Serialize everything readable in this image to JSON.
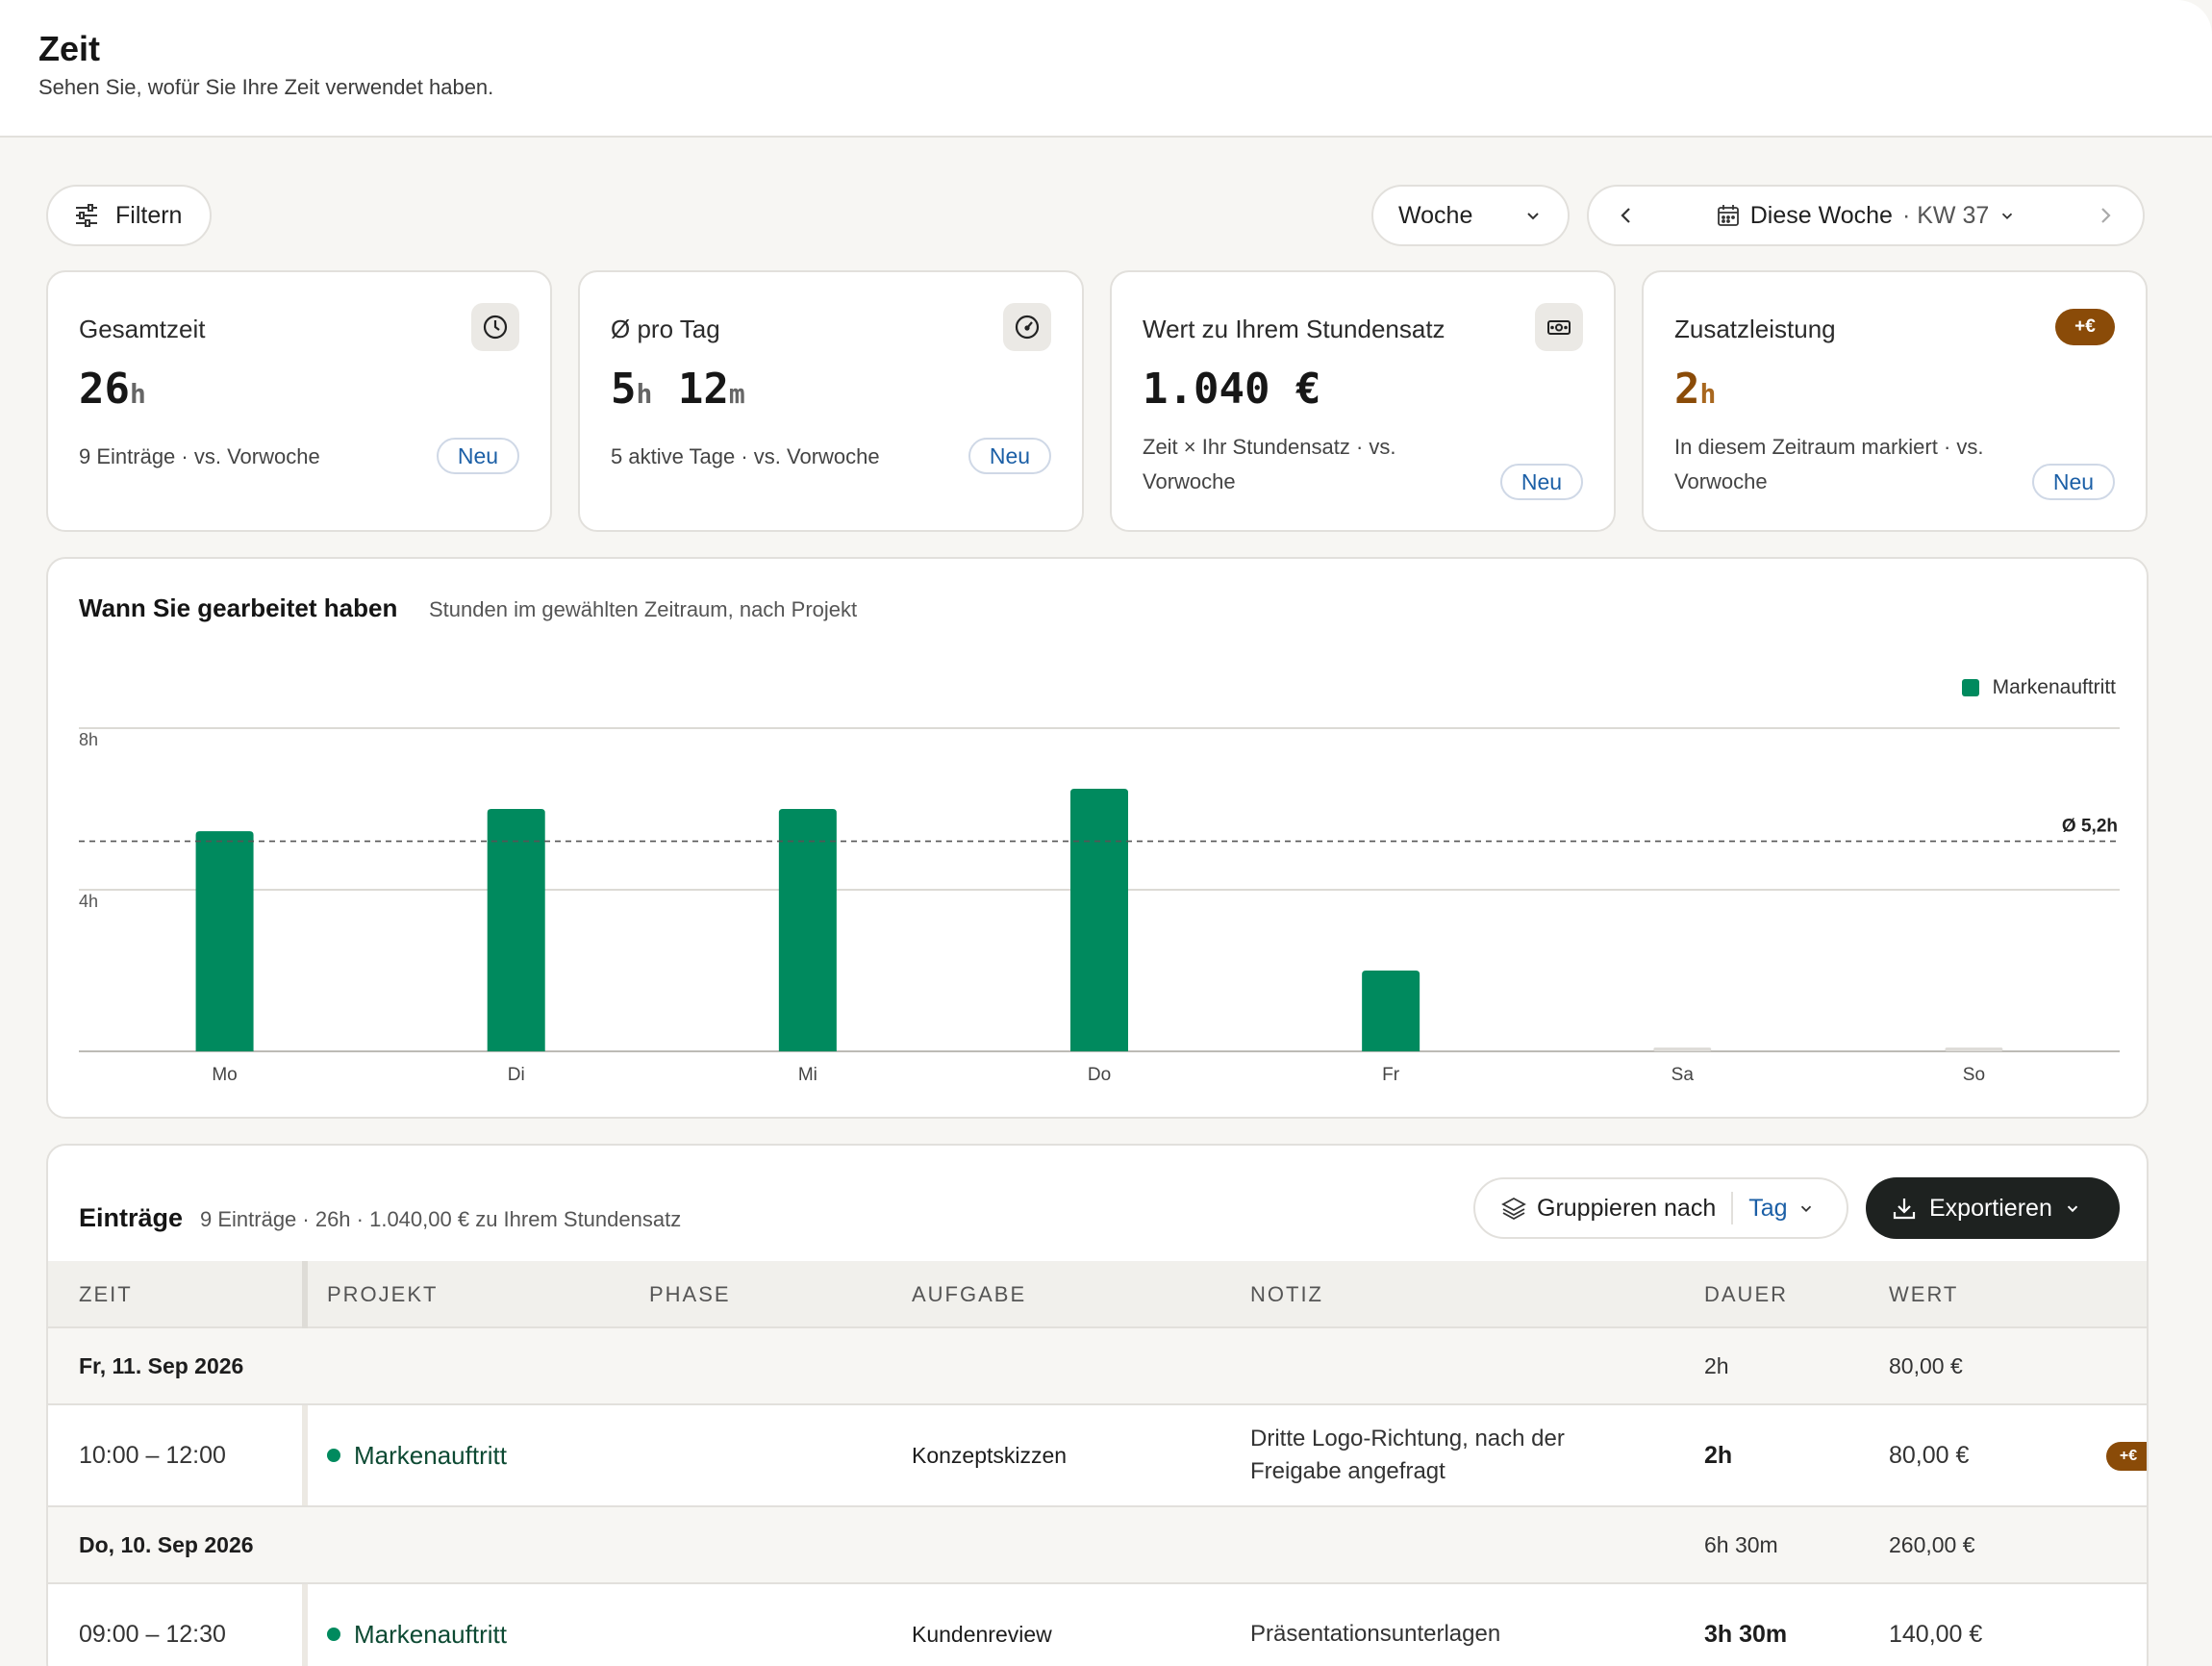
{
  "header": {
    "title": "Zeit",
    "subtitle": "Sehen Sie, wofür Sie Ihre Zeit verwendet haben."
  },
  "toolbar": {
    "filter_label": "Filtern",
    "period_select": "Woche",
    "week_label": "Diese Woche",
    "week_suffix": "· KW 37"
  },
  "cards": [
    {
      "title": "Gesamtzeit",
      "value": "26",
      "unit": "h",
      "sub": "9 Einträge · vs. Vorwoche",
      "badge": "Neu"
    },
    {
      "title": "Ø pro Tag",
      "value_h": "5",
      "unit_h": "h",
      "value_m": "12",
      "unit_m": "m",
      "sub": "5 aktive Tage · vs. Vorwoche",
      "badge": "Neu"
    },
    {
      "title": "Wert zu Ihrem Stundensatz",
      "value": "1.040 €",
      "sub_line1": "Zeit × Ihr Stundensatz · vs.",
      "sub_line2": "Vorwoche",
      "badge": "Neu"
    },
    {
      "title": "Zusatzleistung",
      "value": "2",
      "unit": "h",
      "tag": "+€",
      "sub_line1": "In diesem Zeitraum markiert · vs.",
      "sub_line2": "Vorwoche",
      "badge": "Neu"
    }
  ],
  "chart_card": {
    "title": "Wann Sie gearbeitet haben",
    "subtitle": "Stunden im gewählten Zeitraum, nach Projekt"
  },
  "chart_data": {
    "type": "bar",
    "categories": [
      "Mo",
      "Di",
      "Mi",
      "Do",
      "Fr",
      "Sa",
      "So"
    ],
    "series": [
      {
        "name": "Markenauftritt",
        "values": [
          5.45,
          6.0,
          6.0,
          6.5,
          2.0,
          0,
          0
        ],
        "color": "#008a5e"
      }
    ],
    "y_ticks": [
      "8h",
      "4h"
    ],
    "y_tick_values": [
      8,
      4
    ],
    "ylim": [
      0,
      8
    ],
    "average": 5.2,
    "average_label": "Ø 5,2h",
    "legend_position": "top-right",
    "grid": true
  },
  "entries": {
    "title": "Einträge",
    "subtitle": "9 Einträge · 26h · 1.040,00 € zu Ihrem Stundensatz",
    "group_label": "Gruppieren nach",
    "group_value": "Tag",
    "export_label": "Exportieren",
    "columns": [
      "ZEIT",
      "PROJEKT",
      "PHASE",
      "AUFGABE",
      "NOTIZ",
      "DAUER",
      "WERT"
    ],
    "rows": [
      {
        "kind": "day",
        "label": "Fr, 11. Sep 2026",
        "duration": "2h",
        "value": "80,00 €"
      },
      {
        "kind": "entry",
        "time": "10:00 – 12:00",
        "project": "Markenauftritt",
        "task": "Konzeptskizzen",
        "note_line1": "Dritte Logo-Richtung, nach der",
        "note_line2": "Freigabe angefragt",
        "duration": "2h",
        "value": "80,00 €",
        "extra": "+€"
      },
      {
        "kind": "day",
        "label": "Do, 10. Sep 2026",
        "duration": "6h 30m",
        "value": "260,00 €"
      },
      {
        "kind": "entry",
        "time": "09:00 – 12:30",
        "project": "Markenauftritt",
        "task": "Kundenreview",
        "note_line1": "Präsentationsunterlagen",
        "note_line2": "",
        "duration": "3h 30m",
        "value": "140,00 €"
      }
    ]
  }
}
